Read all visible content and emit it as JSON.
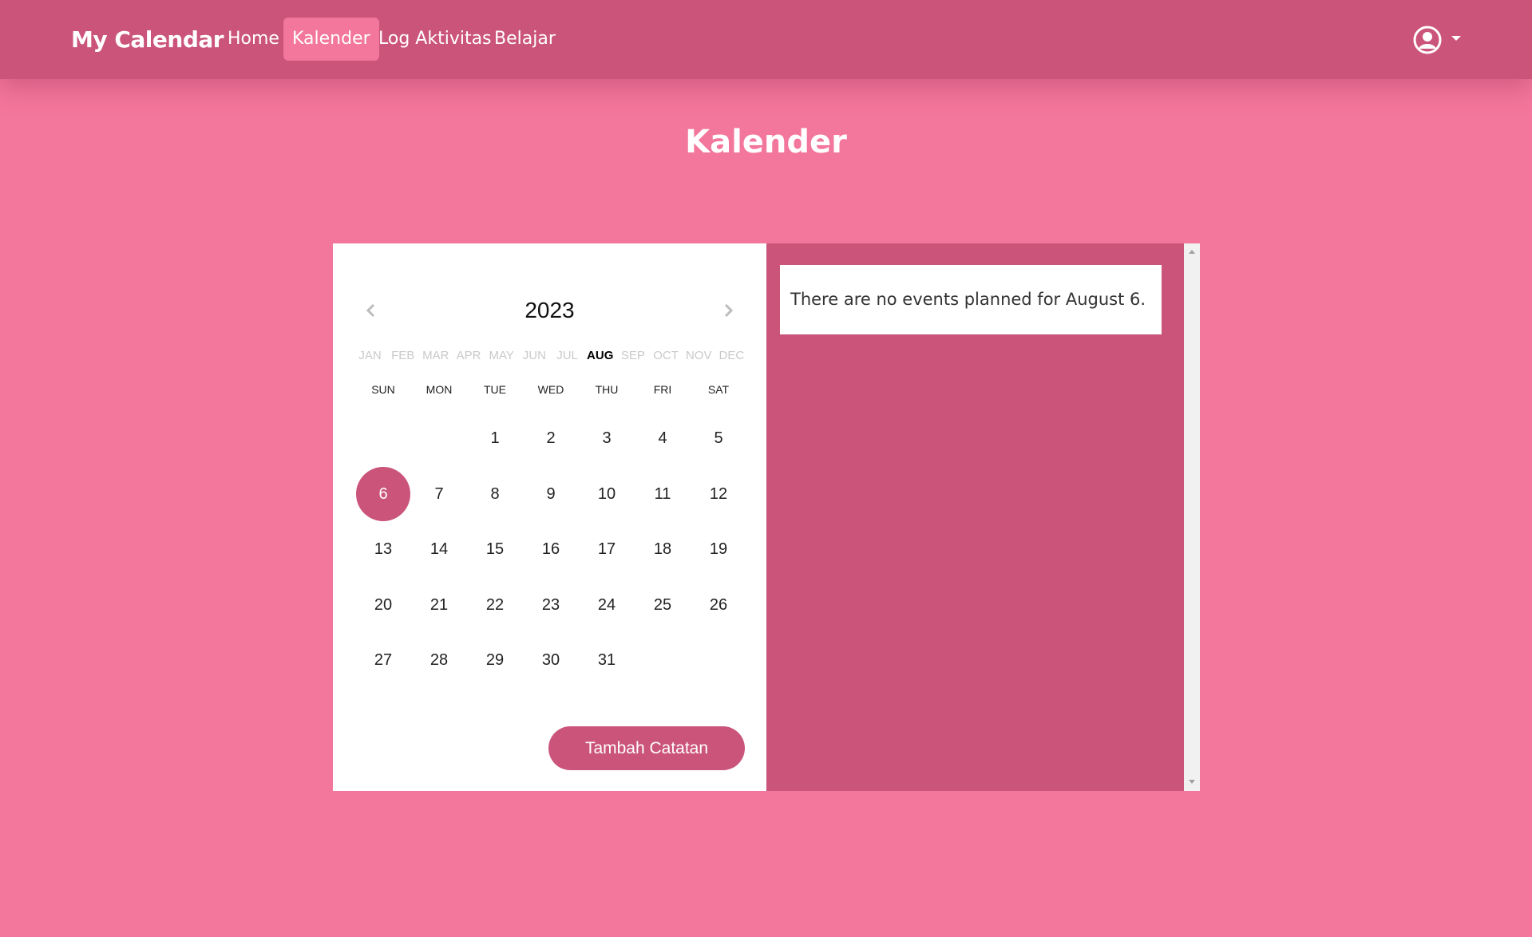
{
  "navbar": {
    "brand": "My Calendar",
    "links": [
      {
        "label": "Home",
        "active": false
      },
      {
        "label": "Kalender",
        "active": true
      },
      {
        "label": "Log Aktivitas",
        "active": false
      },
      {
        "label": "Belajar",
        "active": false
      }
    ],
    "user_icon": "user-circle-icon"
  },
  "page_title": "Kalender",
  "calendar": {
    "year": "2023",
    "months": [
      "JAN",
      "FEB",
      "MAR",
      "APR",
      "MAY",
      "JUN",
      "JUL",
      "AUG",
      "SEP",
      "OCT",
      "NOV",
      "DEC"
    ],
    "active_month": "AUG",
    "weekdays": [
      "SUN",
      "MON",
      "TUE",
      "WED",
      "THU",
      "FRI",
      "SAT"
    ],
    "first_weekday_index": 2,
    "days_in_month": 31,
    "selected_day": 6,
    "add_button": "Tambah Catatan"
  },
  "events": {
    "message": "There are no events planned for August 6."
  },
  "colors": {
    "background": "#f3769c",
    "primary": "#cb547b",
    "panel": "#ffffff"
  }
}
